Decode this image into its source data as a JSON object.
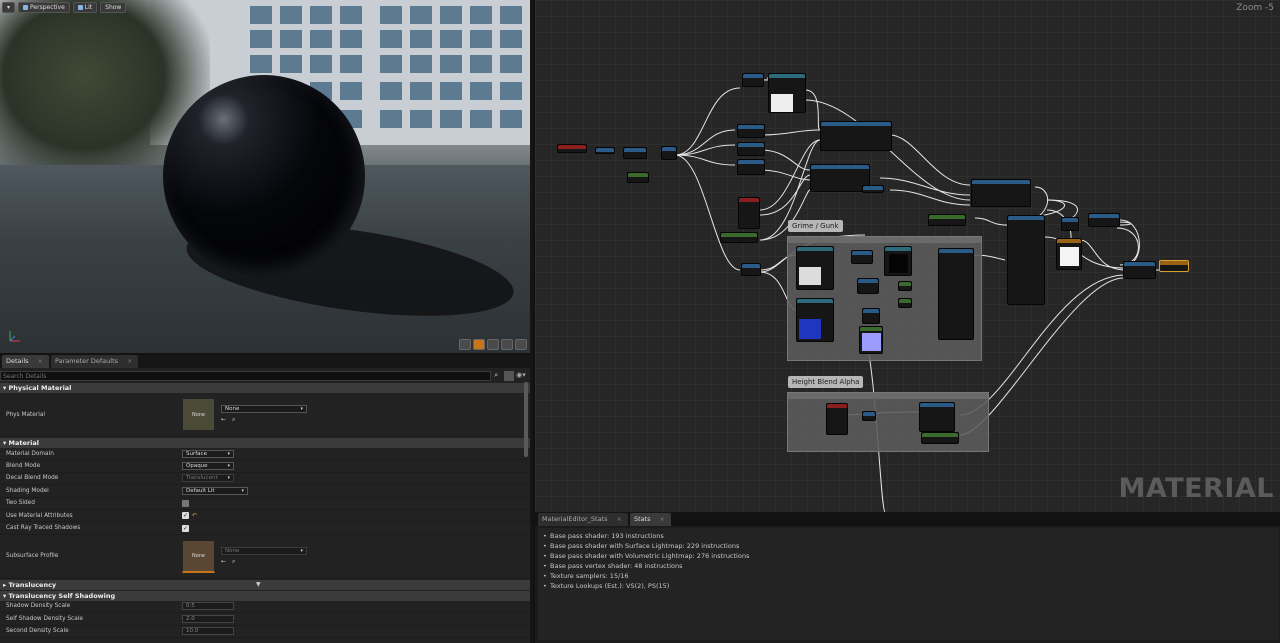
{
  "viewport": {
    "toolbar": {
      "menu_glyph": "▾",
      "perspective": "Perspective",
      "lit": "Lit",
      "show": "Show"
    }
  },
  "details": {
    "tabs": [
      {
        "label": "Details"
      },
      {
        "label": "Parameter Defaults"
      }
    ],
    "search_placeholder": "Search Details",
    "sections": {
      "physical_material": "Physical Material",
      "material": "Material",
      "translucency": "Translucency",
      "translucency_self_shadowing": "Translucency Self Shadowing"
    },
    "phys_material": {
      "label": "Phys Material",
      "thumb": "None",
      "value": "None"
    },
    "material_domain": {
      "label": "Material Domain",
      "value": "Surface"
    },
    "blend_mode": {
      "label": "Blend Mode",
      "value": "Opaque"
    },
    "decal_blend_mode": {
      "label": "Decal Blend Mode",
      "value": "Translucent"
    },
    "shading_model": {
      "label": "Shading Model",
      "value": "Default Lit"
    },
    "two_sided": {
      "label": "Two Sided",
      "checked": false
    },
    "use_material_attributes": {
      "label": "Use Material Attributes",
      "checked": true
    },
    "cast_ray_traced_shadows": {
      "label": "Cast Ray Traced Shadows",
      "checked": true
    },
    "subsurface_profile": {
      "label": "Subsurface Profile",
      "thumb": "None",
      "value": "None"
    },
    "shadow_density_scale": {
      "label": "Shadow Density Scale",
      "value": "0.5"
    },
    "self_shadow_density_scale": {
      "label": "Self Shadow Density Scale",
      "value": "2.0"
    },
    "second_density_scale": {
      "label": "Second Density Scale",
      "value": "10.0"
    }
  },
  "graph": {
    "zoom": "Zoom -5",
    "watermark": "MATERIAL",
    "comments": {
      "grime": "Grime / Gunk",
      "height_blend": "Height Blend Alpha"
    }
  },
  "stats": {
    "tabs": [
      {
        "label": "MaterialEditor_Stats"
      },
      {
        "label": "Stats"
      }
    ],
    "lines": [
      "Base pass shader: 193 instructions",
      "Base pass shader with Surface Lightmap: 229 instructions",
      "Base pass shader with Volumetric Lightmap: 276 instructions",
      "Base pass vertex shader: 48 instructions",
      "Texture samplers: 15/16",
      "Texture Lookups (Est.): VS(2), PS(15)"
    ]
  },
  "colors": {
    "accent": "#c8741b",
    "panel": "#222222",
    "graph_bg": "#262626"
  }
}
